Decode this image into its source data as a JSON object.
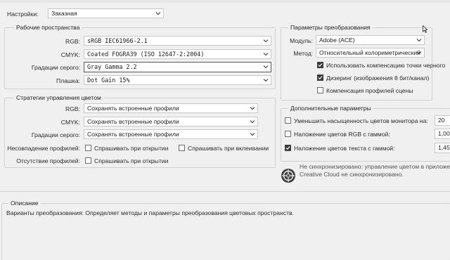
{
  "top": {
    "settings_label": "Настройки:",
    "settings_value": "Заказная"
  },
  "workspaces": {
    "title": "Рабочие пространства",
    "rgb_label": "RGB:",
    "rgb_value": "sRGB IEC61966-2.1",
    "cmyk_label": "CMYK:",
    "cmyk_value": "Coated FOGRA39 (ISO 12647-2:2004)",
    "gray_label": "Градации серого:",
    "gray_value": "Gray Gamma 2.2",
    "spot_label": "Плашка:",
    "spot_value": "Dot Gain 15%"
  },
  "policies": {
    "title": "Стратегии управления цветом",
    "rgb_label": "RGB:",
    "rgb_value": "Сохранять встроенные профили",
    "cmyk_label": "CMYK:",
    "cmyk_value": "Сохранять встроенные профили",
    "gray_label": "Градации серого:",
    "gray_value": "Сохранять встроенные профили",
    "mismatch_label": "Несовпадение профилей:",
    "ask_open": "Спрашивать при открытии",
    "ask_paste": "Спрашивать при вклеивании",
    "missing_label": "Отсутствие профилей:",
    "ask_open2": "Спрашивать при открытии",
    "mismatch_open_checked": false,
    "mismatch_paste_checked": false,
    "missing_open_checked": false
  },
  "conversion": {
    "title": "Параметры преобразования",
    "engine_label": "Модуль:",
    "engine_value": "Adobe (ACE)",
    "intent_label": "Метод:",
    "intent_value": "Относительный колориметрический",
    "bpc_label": "Использовать компенсацию точки черного",
    "bpc_checked": true,
    "dither_label": "Дизеринг (изображения 8 бит/канал)",
    "dither_checked": true,
    "scene_label": "Компенсация профилей сцены",
    "scene_checked": false
  },
  "advanced": {
    "title": "Дополнительные параметры",
    "desat_label": "Уменьшить насыщенность цветов монитора на:",
    "desat_value": "20",
    "desat_checked": false,
    "blend_rgb_label": "Наложение цветов RGB с гаммой:",
    "blend_rgb_value": "1,00",
    "blend_rgb_checked": false,
    "blend_text_label": "Наложение цветов текста с гаммой:",
    "blend_text_value": "1,45",
    "blend_text_checked": true
  },
  "sync": {
    "line1": "Не синхронизировано: управление цветом в приложени",
    "line2": "Creative Cloud не синхронизировано."
  },
  "description": {
    "title": "Описание",
    "text": "Варианты преобразования:  Определяет методы и параметры преобразования цветовых пространств."
  }
}
